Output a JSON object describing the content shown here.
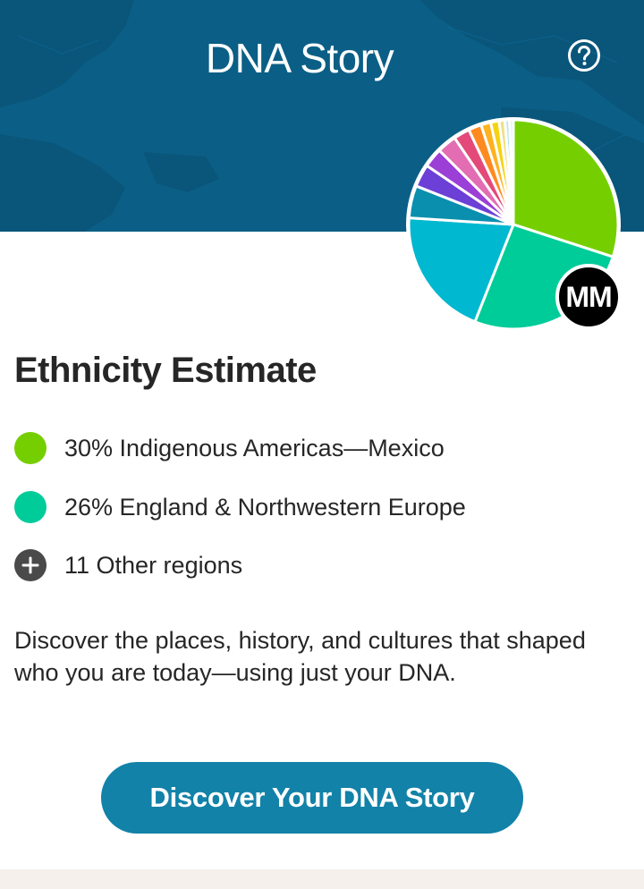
{
  "header": {
    "title": "DNA Story",
    "help_icon": "question-circle-icon",
    "background_color": "#0b5f86"
  },
  "avatar": {
    "initials": "MM"
  },
  "ethnicity": {
    "title": "Ethnicity Estimate",
    "regions": [
      {
        "label": "30% Indigenous Americas—Mexico",
        "color": "#75cf00"
      },
      {
        "label": "26% England & Northwestern Europe",
        "color": "#00cc99"
      }
    ],
    "other": {
      "label": "11 Other regions",
      "icon": "plus-circle-icon"
    }
  },
  "description": "Discover the places, history, and cultures that shaped who you are today—using just your DNA.",
  "cta": {
    "label": "Discover Your DNA Story",
    "color": "#1282a8"
  },
  "chart_data": {
    "type": "pie",
    "title": "",
    "slices": [
      {
        "value": 30,
        "color": "#75cf00"
      },
      {
        "value": 26,
        "color": "#00cc99"
      },
      {
        "value": 20,
        "color": "#00b8d0"
      },
      {
        "value": 5,
        "color": "#0a8fae"
      },
      {
        "value": 3.5,
        "color": "#6c3fd6"
      },
      {
        "value": 3,
        "color": "#9b3fd6"
      },
      {
        "value": 3,
        "color": "#e36db3"
      },
      {
        "value": 2.5,
        "color": "#e34a7a"
      },
      {
        "value": 2,
        "color": "#ff8a1f"
      },
      {
        "value": 1.5,
        "color": "#ffb21f"
      },
      {
        "value": 1.3,
        "color": "#f5d30f"
      },
      {
        "value": 0.9,
        "color": "#f0e080"
      },
      {
        "value": 0.7,
        "color": "#b8e5f0"
      },
      {
        "value": 0.6,
        "color": "#d9f2f7"
      }
    ]
  }
}
